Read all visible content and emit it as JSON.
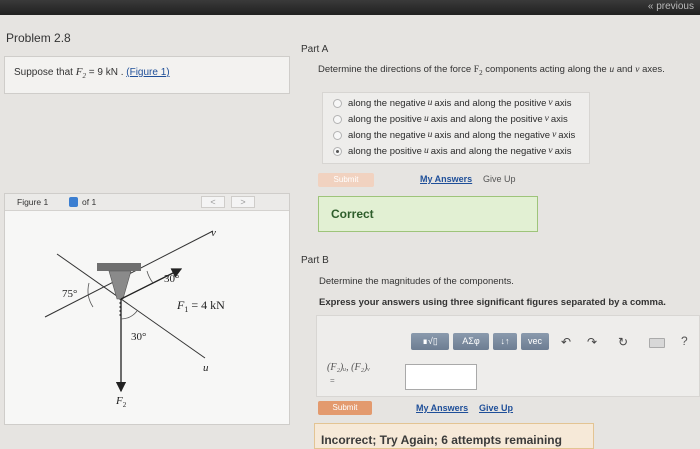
{
  "nav": {
    "previous": "« previous"
  },
  "problem": {
    "title": "Problem 2.8"
  },
  "statement": {
    "prefix": "Suppose that",
    "var": "F",
    "sub": "2",
    "value": " = 9  kN . ",
    "figure_link": "(Figure 1)"
  },
  "part_a": {
    "label": "Part A",
    "prompt_before": "Determine the directions of the force ",
    "force": "F",
    "force_sub": "2",
    "prompt_mid": " components acting along the ",
    "axis_u": "u",
    "and": " and ",
    "axis_v": "v",
    "prompt_end": " axes.",
    "choices": [
      {
        "a": "along the negative ",
        "b": "u",
        "c": " axis and along the positive ",
        "d": "v",
        "e": " axis",
        "selected": false
      },
      {
        "a": "along the positive ",
        "b": "u",
        "c": " axis and along the positive ",
        "d": "v",
        "e": " axis",
        "selected": false
      },
      {
        "a": "along the negative ",
        "b": "u",
        "c": " axis and along the negative ",
        "d": "v",
        "e": " axis",
        "selected": false
      },
      {
        "a": "along the positive ",
        "b": "u",
        "c": " axis and along the negative ",
        "d": "v",
        "e": " axis",
        "selected": true
      }
    ],
    "submit": "Submit",
    "my_answers": "My Answers",
    "give_up": "Give Up",
    "feedback": "Correct"
  },
  "figure": {
    "label": "Figure 1",
    "of": "of 1",
    "prev": "<",
    "next": ">",
    "angle_top": "30°",
    "angle_left": "75°",
    "angle_bottom": "30°",
    "f1_label": "F",
    "f1_sub": "1",
    "f1_value": " = 4 kN",
    "f2_label": "F",
    "f2_sub": "2",
    "axis_u": "u",
    "axis_v": "v"
  },
  "part_b": {
    "label": "Part B",
    "prompt": "Determine the magnitudes of the components.",
    "instruction": "Express your answers using three significant figures separated by a comma.",
    "toolbar": {
      "templates": "∎√▯",
      "greek": "ΑΣφ",
      "arrows": "↓↑",
      "vec": "vec",
      "undo": "↶",
      "redo": "↷",
      "reset": "↻",
      "help": "?"
    },
    "answer_label": "(F₂)ᵤ, (F₂)ᵥ",
    "answer_eq": "=",
    "answer_value": "",
    "submit": "Submit",
    "my_answers": "My Answers",
    "give_up": "Give Up",
    "feedback": "Incorrect; Try Again; 6 attempts remaining"
  },
  "colors": {
    "link": "#1f4f99",
    "correct_bg": "#e2f0d3",
    "incorrect_bg": "#f6e9d8",
    "submit": "#e39a6e"
  }
}
